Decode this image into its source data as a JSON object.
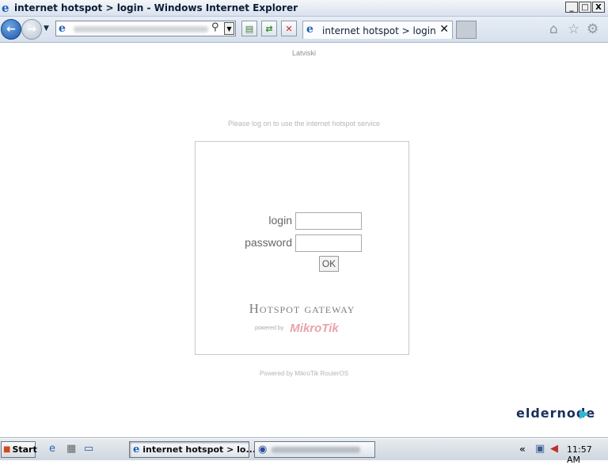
{
  "window": {
    "title": "internet hotspot > login - Windows Internet Explorer",
    "controls": {
      "minimize": "_",
      "maximize": "□",
      "close": "X"
    }
  },
  "navbar": {
    "tab_title": "internet hotspot > login",
    "tab_close": "✕"
  },
  "page": {
    "language_link": "Latviski",
    "notice": "Please log on to use the internet hotspot service",
    "login_label": "login",
    "password_label": "password",
    "ok_button": "OK",
    "gateway_title": "Hotspot gateway",
    "powered_small": "powered by",
    "brand": "MikroTik",
    "footer": "Powered by MikroTik RouterOS"
  },
  "watermark": {
    "text": "eldernode"
  },
  "taskbar": {
    "start_label": "Start",
    "active_task": "internet hotspot > lo...",
    "tray_chevron": "«",
    "clock": "11:57 AM"
  },
  "icons": {
    "ie": "e",
    "back": "←",
    "forward": "→",
    "search": "⚲",
    "refresh": "⇄",
    "stop": "✕",
    "home": "⌂",
    "favorites": "☆",
    "tools": "⚙"
  },
  "colors": {
    "accent": "#1c5fb8",
    "brand": "#e8a3a9"
  }
}
